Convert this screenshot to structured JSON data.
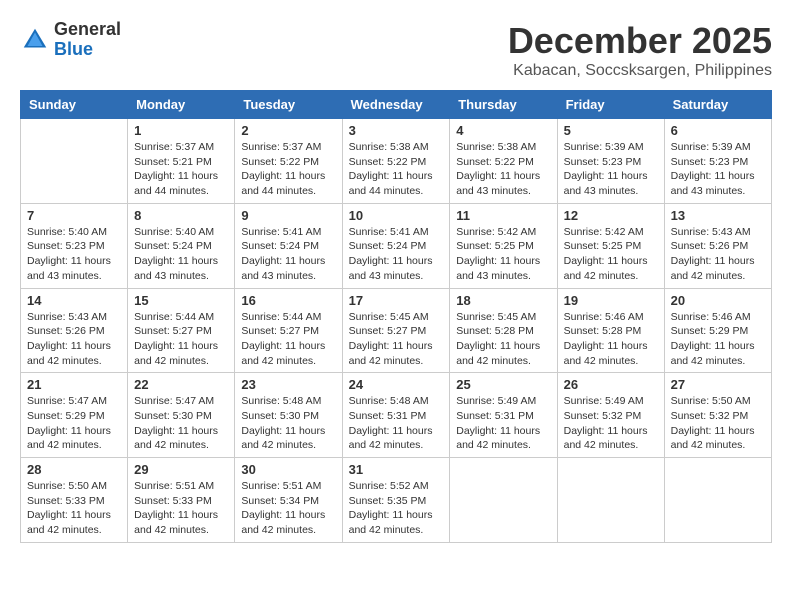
{
  "header": {
    "logo_general": "General",
    "logo_blue": "Blue",
    "month_title": "December 2025",
    "location": "Kabacan, Soccsksargen, Philippines"
  },
  "weekdays": [
    "Sunday",
    "Monday",
    "Tuesday",
    "Wednesday",
    "Thursday",
    "Friday",
    "Saturday"
  ],
  "weeks": [
    [
      {
        "day": "",
        "info": ""
      },
      {
        "day": "1",
        "info": "Sunrise: 5:37 AM\nSunset: 5:21 PM\nDaylight: 11 hours\nand 44 minutes."
      },
      {
        "day": "2",
        "info": "Sunrise: 5:37 AM\nSunset: 5:22 PM\nDaylight: 11 hours\nand 44 minutes."
      },
      {
        "day": "3",
        "info": "Sunrise: 5:38 AM\nSunset: 5:22 PM\nDaylight: 11 hours\nand 44 minutes."
      },
      {
        "day": "4",
        "info": "Sunrise: 5:38 AM\nSunset: 5:22 PM\nDaylight: 11 hours\nand 43 minutes."
      },
      {
        "day": "5",
        "info": "Sunrise: 5:39 AM\nSunset: 5:23 PM\nDaylight: 11 hours\nand 43 minutes."
      },
      {
        "day": "6",
        "info": "Sunrise: 5:39 AM\nSunset: 5:23 PM\nDaylight: 11 hours\nand 43 minutes."
      }
    ],
    [
      {
        "day": "7",
        "info": "Sunrise: 5:40 AM\nSunset: 5:23 PM\nDaylight: 11 hours\nand 43 minutes."
      },
      {
        "day": "8",
        "info": "Sunrise: 5:40 AM\nSunset: 5:24 PM\nDaylight: 11 hours\nand 43 minutes."
      },
      {
        "day": "9",
        "info": "Sunrise: 5:41 AM\nSunset: 5:24 PM\nDaylight: 11 hours\nand 43 minutes."
      },
      {
        "day": "10",
        "info": "Sunrise: 5:41 AM\nSunset: 5:24 PM\nDaylight: 11 hours\nand 43 minutes."
      },
      {
        "day": "11",
        "info": "Sunrise: 5:42 AM\nSunset: 5:25 PM\nDaylight: 11 hours\nand 43 minutes."
      },
      {
        "day": "12",
        "info": "Sunrise: 5:42 AM\nSunset: 5:25 PM\nDaylight: 11 hours\nand 42 minutes."
      },
      {
        "day": "13",
        "info": "Sunrise: 5:43 AM\nSunset: 5:26 PM\nDaylight: 11 hours\nand 42 minutes."
      }
    ],
    [
      {
        "day": "14",
        "info": "Sunrise: 5:43 AM\nSunset: 5:26 PM\nDaylight: 11 hours\nand 42 minutes."
      },
      {
        "day": "15",
        "info": "Sunrise: 5:44 AM\nSunset: 5:27 PM\nDaylight: 11 hours\nand 42 minutes."
      },
      {
        "day": "16",
        "info": "Sunrise: 5:44 AM\nSunset: 5:27 PM\nDaylight: 11 hours\nand 42 minutes."
      },
      {
        "day": "17",
        "info": "Sunrise: 5:45 AM\nSunset: 5:27 PM\nDaylight: 11 hours\nand 42 minutes."
      },
      {
        "day": "18",
        "info": "Sunrise: 5:45 AM\nSunset: 5:28 PM\nDaylight: 11 hours\nand 42 minutes."
      },
      {
        "day": "19",
        "info": "Sunrise: 5:46 AM\nSunset: 5:28 PM\nDaylight: 11 hours\nand 42 minutes."
      },
      {
        "day": "20",
        "info": "Sunrise: 5:46 AM\nSunset: 5:29 PM\nDaylight: 11 hours\nand 42 minutes."
      }
    ],
    [
      {
        "day": "21",
        "info": "Sunrise: 5:47 AM\nSunset: 5:29 PM\nDaylight: 11 hours\nand 42 minutes."
      },
      {
        "day": "22",
        "info": "Sunrise: 5:47 AM\nSunset: 5:30 PM\nDaylight: 11 hours\nand 42 minutes."
      },
      {
        "day": "23",
        "info": "Sunrise: 5:48 AM\nSunset: 5:30 PM\nDaylight: 11 hours\nand 42 minutes."
      },
      {
        "day": "24",
        "info": "Sunrise: 5:48 AM\nSunset: 5:31 PM\nDaylight: 11 hours\nand 42 minutes."
      },
      {
        "day": "25",
        "info": "Sunrise: 5:49 AM\nSunset: 5:31 PM\nDaylight: 11 hours\nand 42 minutes."
      },
      {
        "day": "26",
        "info": "Sunrise: 5:49 AM\nSunset: 5:32 PM\nDaylight: 11 hours\nand 42 minutes."
      },
      {
        "day": "27",
        "info": "Sunrise: 5:50 AM\nSunset: 5:32 PM\nDaylight: 11 hours\nand 42 minutes."
      }
    ],
    [
      {
        "day": "28",
        "info": "Sunrise: 5:50 AM\nSunset: 5:33 PM\nDaylight: 11 hours\nand 42 minutes."
      },
      {
        "day": "29",
        "info": "Sunrise: 5:51 AM\nSunset: 5:33 PM\nDaylight: 11 hours\nand 42 minutes."
      },
      {
        "day": "30",
        "info": "Sunrise: 5:51 AM\nSunset: 5:34 PM\nDaylight: 11 hours\nand 42 minutes."
      },
      {
        "day": "31",
        "info": "Sunrise: 5:52 AM\nSunset: 5:35 PM\nDaylight: 11 hours\nand 42 minutes."
      },
      {
        "day": "",
        "info": ""
      },
      {
        "day": "",
        "info": ""
      },
      {
        "day": "",
        "info": ""
      }
    ]
  ]
}
